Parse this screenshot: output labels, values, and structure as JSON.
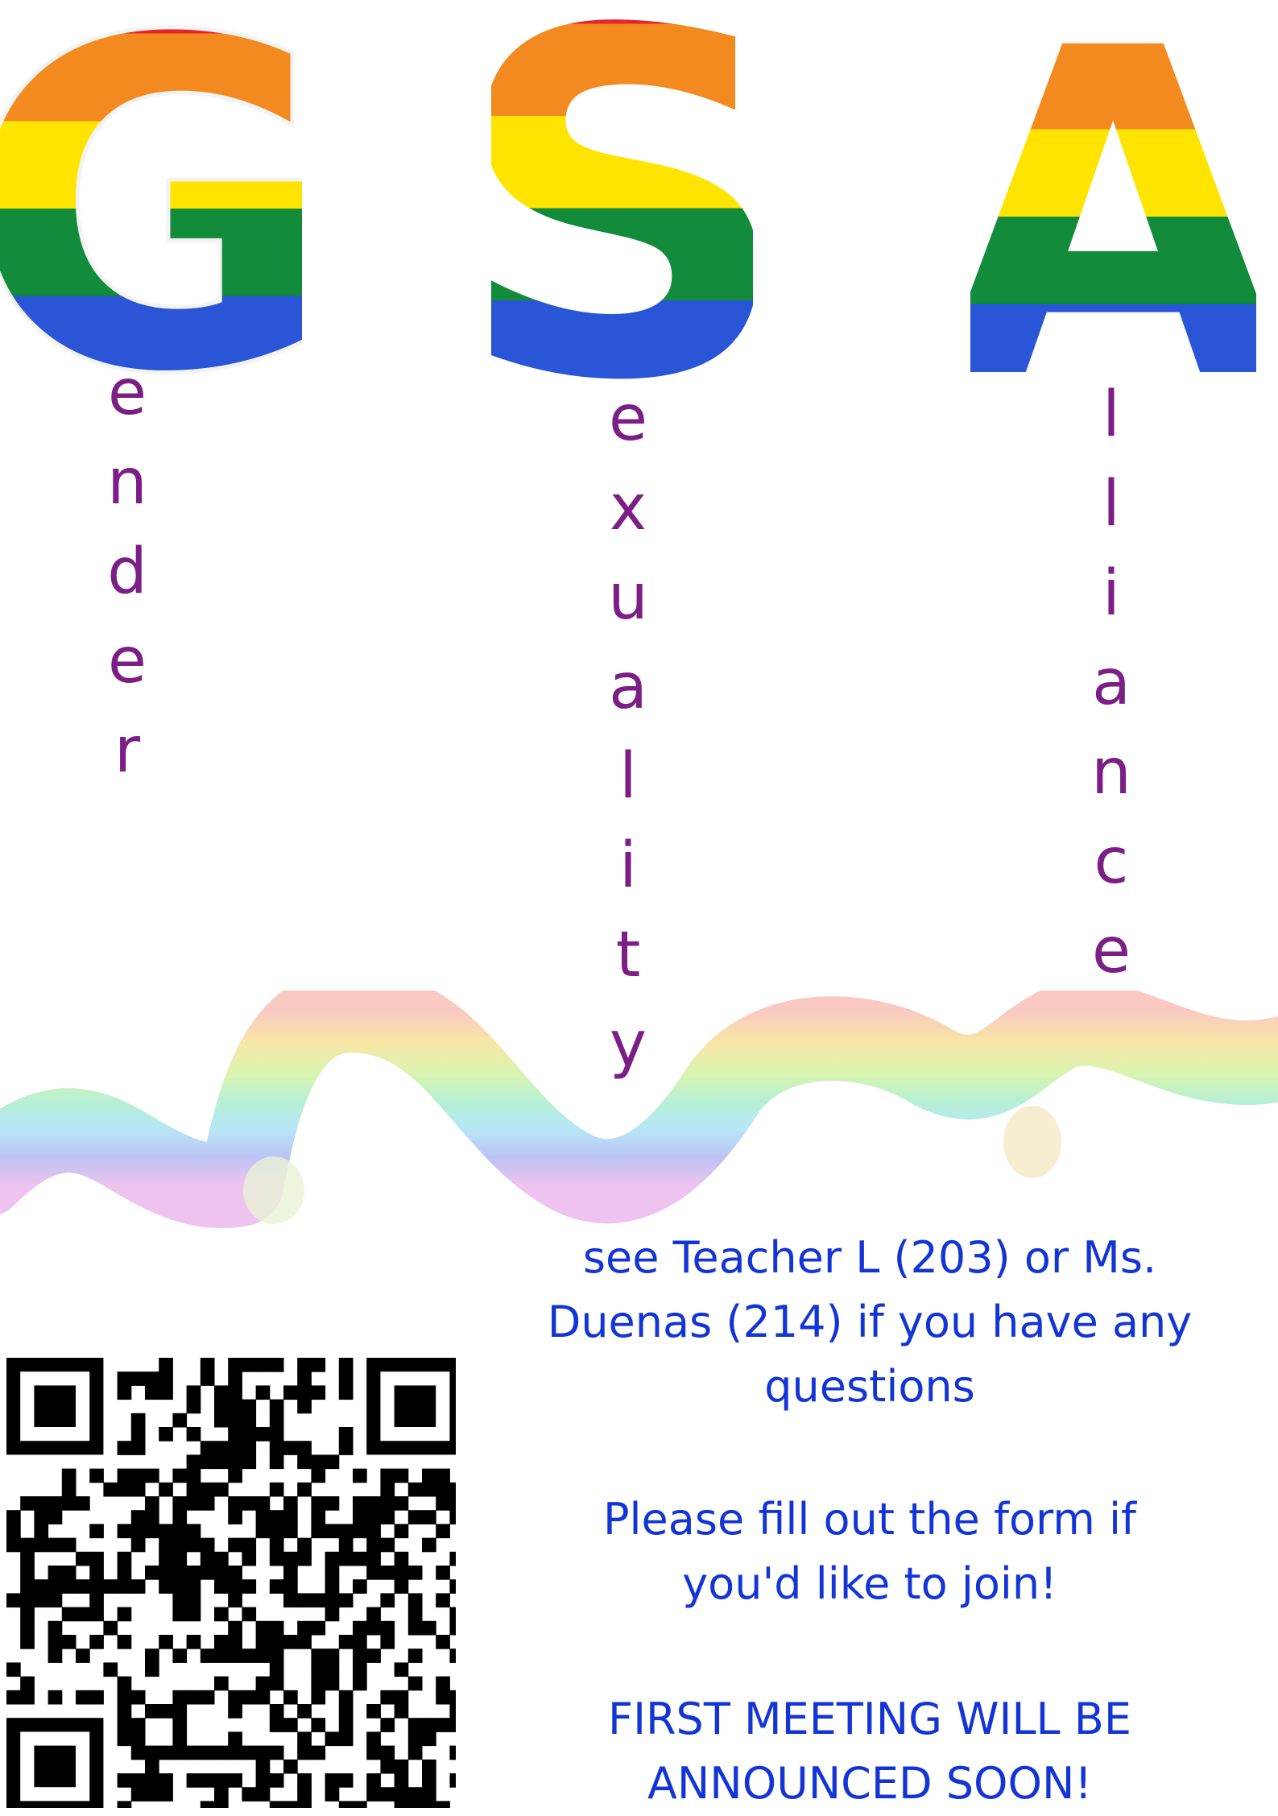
{
  "header": {
    "letters": [
      "G",
      "S",
      "A"
    ],
    "words": [
      {
        "rest": "ender",
        "letters": [
          "e",
          "n",
          "d",
          "e",
          "r"
        ]
      },
      {
        "rest": "exuality",
        "letters": [
          "e",
          "x",
          "u",
          "a",
          "l",
          "i",
          "t",
          "y"
        ]
      },
      {
        "rest": "lliance",
        "letters": [
          "l",
          "l",
          "i",
          "a",
          "n",
          "c",
          "e"
        ]
      }
    ]
  },
  "rainbow_colors": [
    "#e4262b",
    "#f38a1f",
    "#ffe400",
    "#128b3b",
    "#2a55d6",
    "#7a1c8a"
  ],
  "text_colors": {
    "acronym": "#7b1f86",
    "info": "#1435d6"
  },
  "info": {
    "contact_lines": [
      "see Teacher L (203) or Ms.",
      "Duenas (214) if you have any",
      "questions"
    ],
    "join_lines": [
      "Please fill out the form if",
      "you'd like to join!"
    ],
    "meeting_lines": [
      "FIRST MEETING WILL BE",
      "ANNOUNCED SOON!"
    ]
  },
  "qr_icon": "qr-code-icon"
}
